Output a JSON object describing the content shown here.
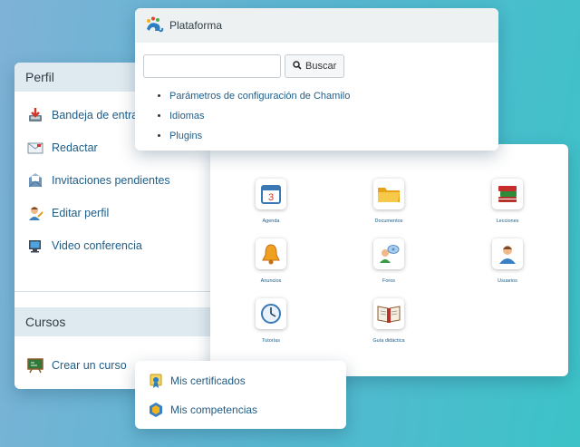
{
  "perfil": {
    "title": "Perfil",
    "items": [
      {
        "label": "Bandeja de entra",
        "icon": "inbox-icon"
      },
      {
        "label": "Redactar",
        "icon": "envelope-icon"
      },
      {
        "label": "Invitaciones pendientes",
        "icon": "invitations-icon"
      },
      {
        "label": "Editar perfil",
        "icon": "user-edit-icon"
      },
      {
        "label": "Video conferencia",
        "icon": "video-conference-icon"
      }
    ]
  },
  "cursos": {
    "title": "Cursos",
    "create_label": "Crear un curso"
  },
  "plataforma": {
    "title": "Plataforma",
    "search_placeholder": "",
    "search_button": "Buscar",
    "links": [
      "Parámetros de configuración de Chamilo",
      "Idiomas",
      "Plugins"
    ]
  },
  "tools": [
    {
      "label": "Agenda",
      "icon": "calendar-icon"
    },
    {
      "label": "Documentos",
      "icon": "folder-icon"
    },
    {
      "label": "Lecciones",
      "icon": "books-icon"
    },
    {
      "label": "Anuncios",
      "icon": "bell-icon"
    },
    {
      "label": "Foros",
      "icon": "forum-icon"
    },
    {
      "label": "Usuarios",
      "icon": "users-icon"
    },
    {
      "label": "Tutorías",
      "icon": "clock-icon"
    },
    {
      "label": "Guía didáctica",
      "icon": "guide-book-icon"
    }
  ],
  "certs": {
    "items": [
      {
        "label": "Mis certificados",
        "icon": "certificate-icon"
      },
      {
        "label": "Mis competencias",
        "icon": "skills-badge-icon"
      }
    ]
  },
  "colors": {
    "link": "#1f5d87",
    "panel_header": "#dfeaf0",
    "background_start": "#7fb2d6",
    "background_end": "#3cc3c8"
  }
}
